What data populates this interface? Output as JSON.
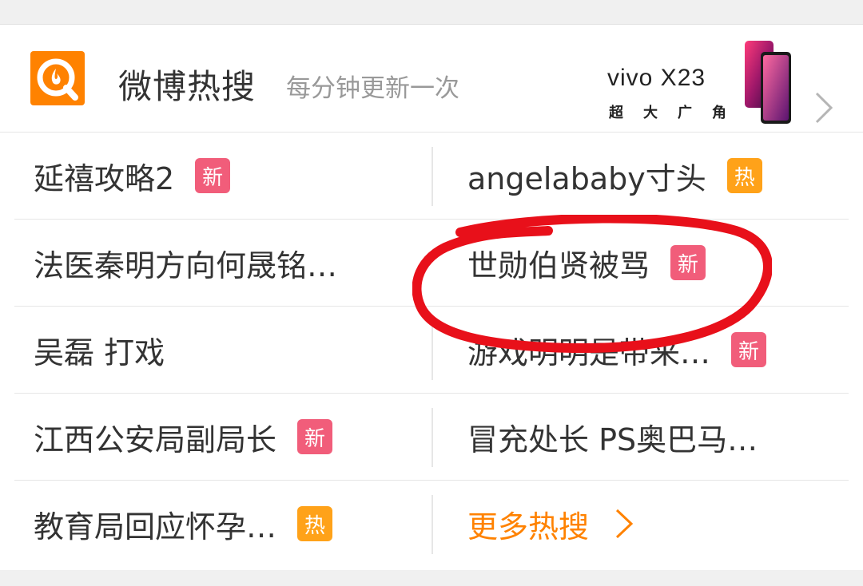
{
  "header": {
    "title": "微博热搜",
    "subtitle": "每分钟更新一次",
    "ad_brand": "vivo X23",
    "ad_tagline": "超大广角"
  },
  "rows": [
    {
      "left": {
        "text": "延禧攻略2",
        "badge": "新",
        "badge_type": "new"
      },
      "right": {
        "text": "angelababy寸头",
        "badge": "热",
        "badge_type": "hot"
      }
    },
    {
      "left": {
        "text": "法医秦明方向何晟铭…",
        "badge": "",
        "badge_type": ""
      },
      "right": {
        "text": "世勋伯贤被骂",
        "badge": "新",
        "badge_type": "new"
      }
    },
    {
      "left": {
        "text": "吴磊 打戏",
        "badge": "",
        "badge_type": ""
      },
      "right": {
        "text": "游戏明明是带来…",
        "badge": "新",
        "badge_type": "new"
      }
    },
    {
      "left": {
        "text": "江西公安局副局长",
        "badge": "新",
        "badge_type": "new"
      },
      "right": {
        "text": "冒充处长 PS奥巴马…",
        "badge": "",
        "badge_type": ""
      }
    },
    {
      "left": {
        "text": "教育局回应怀孕…",
        "badge": "热",
        "badge_type": "hot"
      },
      "right": {
        "text": "更多热搜",
        "badge": "",
        "badge_type": ""
      }
    }
  ],
  "colors": {
    "accent": "#ff8200",
    "badge_new": "#f15d7a",
    "badge_hot": "#ffa219",
    "annotation": "#e8101a"
  },
  "icons": {
    "logo": "weibo-hot-search-icon",
    "header_chevron": "chevron-right-icon",
    "more_chevron": "chevron-right-icon"
  }
}
